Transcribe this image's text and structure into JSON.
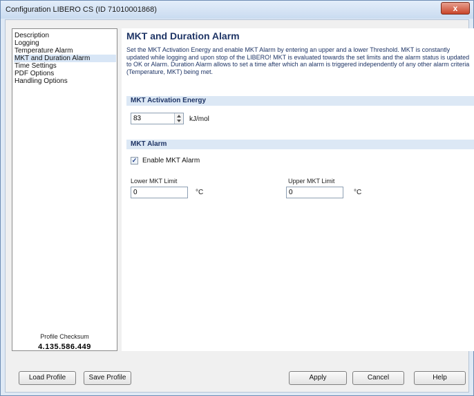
{
  "window": {
    "title": "Configuration LIBERO CS (ID 71010001868)",
    "close_label": "x"
  },
  "sidebar": {
    "items": [
      {
        "label": "Description"
      },
      {
        "label": "Logging"
      },
      {
        "label": "Temperature Alarm"
      },
      {
        "label": "MKT and Duration Alarm",
        "selected": true
      },
      {
        "label": "Time Settings"
      },
      {
        "label": "PDF Options"
      },
      {
        "label": "Handling Options"
      }
    ],
    "checksum_label": "Profile Checksum",
    "checksum_value": "4.135.586.449"
  },
  "main": {
    "title": "MKT and Duration Alarm",
    "description": "Set the MKT Activation Energy and enable MKT Alarm by entering an upper and a lower Threshold. MKT is constantly updated while logging and upon stop of the LIBERO! MKT is evaluated towards the set limits and the alarm status is updated to OK or Alarm. Duration Alarm allows to set a time after which an alarm is triggered independently of any other alarm criteria (Temperature, MKT) being met.",
    "activation_section": {
      "header": "MKT Activation Energy",
      "value": "83",
      "unit": "kJ/mol"
    },
    "alarm_section": {
      "header": "MKT Alarm",
      "enable_label": "Enable MKT Alarm",
      "enable_checked": true,
      "check_glyph": "✓",
      "lower_label": "Lower MKT Limit",
      "lower_value": "0",
      "lower_unit": "°C",
      "upper_label": "Upper MKT Limit",
      "upper_value": "0",
      "upper_unit": "°C"
    }
  },
  "footer": {
    "load_label": "Load Profile",
    "save_label": "Save Profile",
    "apply_label": "Apply",
    "cancel_label": "Cancel",
    "help_label": "Help"
  }
}
